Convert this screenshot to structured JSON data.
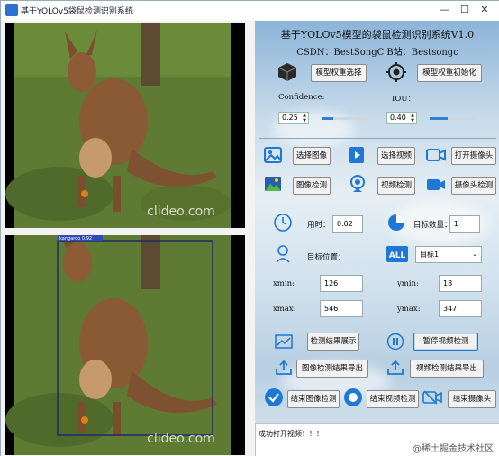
{
  "window": {
    "title": "基于YOLOv5袋鼠检测识别系统",
    "controls": [
      "—",
      "☐",
      "✕"
    ]
  },
  "header": {
    "title": "基于YOLOv5模型的袋鼠检测识别系统V1.0",
    "subtitle": "CSDN：BestSongC   B站：Bestsongc"
  },
  "model": {
    "select_label": "模型权重选择",
    "init_label": "模型权重初始化",
    "confidence_label": "Confidence:",
    "confidence_value": "0.25",
    "confidence_level": 0.25,
    "iou_label": "IOU：",
    "iou_value": "0.40",
    "iou_level": 0.4
  },
  "source": {
    "select_image": "选择图像",
    "select_video": "选择视频",
    "open_camera": "打开摄像头",
    "image_detect": "图像检测",
    "video_detect": "视频检测",
    "camera_detect": "摄像头检测"
  },
  "results": {
    "time_label": "用时：",
    "time_value": "0.02",
    "count_label": "目标数量：",
    "count_value": "1",
    "position_label": "目标位置：",
    "target_select": "目标1",
    "xmin_label": "xmin:",
    "xmin_value": "126",
    "ymin_label": "ymin:",
    "ymin_value": "18",
    "xmax_label": "xmax:",
    "xmax_value": "546",
    "ymax_label": "ymax:",
    "ymax_value": "347"
  },
  "actions": {
    "show_results": "检测结果展示",
    "pause_video": "暂停视频检测",
    "export_image": "图像检测结果导出",
    "export_video": "视频检测结果导出",
    "end_image": "结束图像检测",
    "end_video": "结束视频检测",
    "end_camera": "结束摄像头"
  },
  "images": {
    "watermark": "clideo.com",
    "detection_tag": "kangaroo 0.92"
  },
  "status": {
    "message": "成功打开视频！！！"
  },
  "watermark": "@稀土掘金技术社区",
  "colors": {
    "accent": "#2f7fd6",
    "title_icon": "#2f6fd0"
  }
}
